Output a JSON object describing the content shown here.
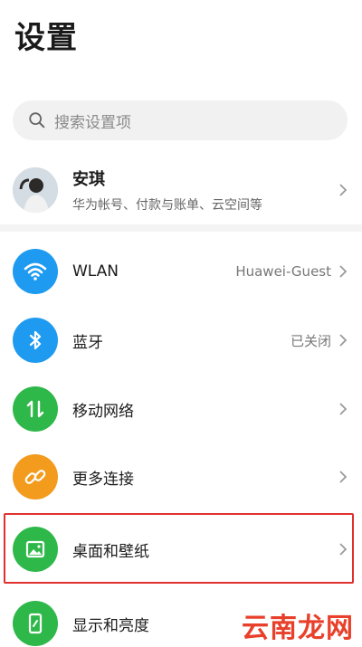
{
  "page": {
    "title": "设置"
  },
  "search": {
    "placeholder": "搜索设置项",
    "icon": "search-icon"
  },
  "account": {
    "name": "安琪",
    "subtitle": "华为帐号、付款与账单、云空间等"
  },
  "items": [
    {
      "label": "WLAN",
      "value": "Huawei-Guest",
      "icon": "wifi-icon",
      "color": "#1e9bf0"
    },
    {
      "label": "蓝牙",
      "value": "已关闭",
      "icon": "bluetooth-icon",
      "color": "#1e9bf0"
    },
    {
      "label": "移动网络",
      "value": "",
      "icon": "mobile-data-icon",
      "color": "#2fb84a"
    },
    {
      "label": "更多连接",
      "value": "",
      "icon": "link-icon",
      "color": "#f29b1d"
    },
    {
      "label": "桌面和壁纸",
      "value": "",
      "icon": "wallpaper-icon",
      "color": "#2fb84a"
    },
    {
      "label": "显示和亮度",
      "value": "",
      "icon": "display-icon",
      "color": "#2fb84a"
    }
  ],
  "highlight_color": "#e0312f",
  "watermark": "云南龙网"
}
